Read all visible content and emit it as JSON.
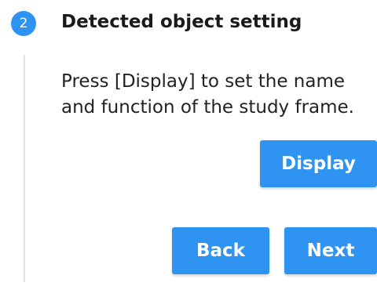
{
  "step": {
    "number": "2",
    "title": "Detected object setting",
    "description": "Press [Display] to set the name and function of the study frame."
  },
  "buttons": {
    "display_label": "Display",
    "back_label": "Back",
    "next_label": "Next"
  },
  "colors": {
    "accent": "#2f93f2",
    "connector_line": "#e3e3e3",
    "text": "#1a1a1a"
  }
}
